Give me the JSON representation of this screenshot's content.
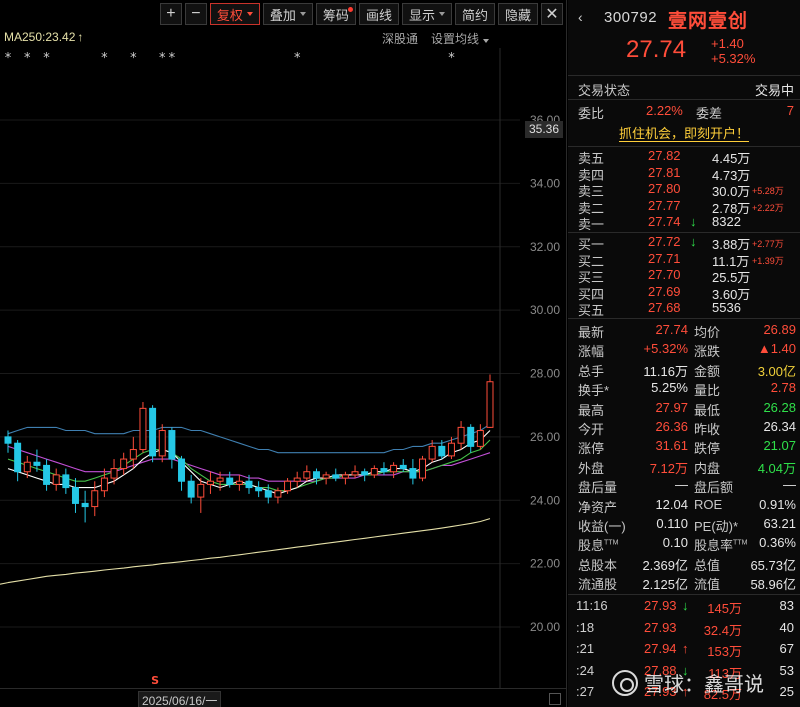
{
  "toolbar": {
    "plus": "+",
    "minus": "−",
    "fuquan": "复权",
    "diejia": "叠加",
    "chouma": "筹码",
    "huaxian": "画线",
    "xianshi": "显示",
    "jianyue": "简约",
    "yincang": "隐藏",
    "close": "✕"
  },
  "subbar": {
    "ma250": "MA250:23.42",
    "ma250_arrow": "↑",
    "shengutong": "深股通",
    "ma_setting": "设置均线"
  },
  "markers": {
    "event_mark": "*",
    "s_mark": "S"
  },
  "bottom": {
    "date": "2025/06/16/一"
  },
  "colors": {
    "up": "#ff4d3a",
    "down": "#25c8e6",
    "ma250": "#e5e0a8",
    "ma_blue": "#3f7fb0",
    "ma_purple": "#c24fd6",
    "ma_green": "#46c24a",
    "ma_white": "#ffffff"
  },
  "chart_data": {
    "type": "candlestick",
    "y_ticks": [
      "36.00",
      "34.00",
      "32.00",
      "30.00",
      "28.00",
      "26.00",
      "24.00",
      "22.00",
      "20.00"
    ],
    "ylim": [
      19.4,
      36.8
    ],
    "current_axis_label": "35.36",
    "ohlc": [
      [
        26.0,
        26.2,
        25.5,
        25.8
      ],
      [
        25.8,
        25.9,
        24.6,
        24.9
      ],
      [
        24.9,
        25.4,
        24.7,
        25.2
      ],
      [
        25.2,
        25.6,
        24.9,
        25.1
      ],
      [
        25.1,
        25.3,
        24.3,
        24.5
      ],
      [
        24.5,
        25.0,
        24.3,
        24.8
      ],
      [
        24.8,
        25.0,
        24.2,
        24.4
      ],
      [
        24.4,
        24.7,
        23.6,
        23.9
      ],
      [
        23.9,
        24.3,
        23.3,
        23.8
      ],
      [
        23.8,
        24.6,
        23.5,
        24.3
      ],
      [
        24.3,
        25.0,
        24.1,
        24.7
      ],
      [
        24.7,
        25.3,
        24.5,
        25.0
      ],
      [
        25.0,
        25.5,
        24.8,
        25.3
      ],
      [
        25.3,
        26.0,
        25.0,
        25.6
      ],
      [
        25.6,
        27.1,
        25.5,
        26.9
      ],
      [
        26.9,
        27.0,
        25.2,
        25.4
      ],
      [
        25.4,
        26.4,
        25.2,
        26.2
      ],
      [
        26.2,
        26.3,
        25.0,
        25.3
      ],
      [
        25.3,
        25.4,
        24.3,
        24.6
      ],
      [
        24.6,
        24.8,
        23.9,
        24.1
      ],
      [
        24.1,
        24.7,
        23.6,
        24.5
      ],
      [
        24.5,
        24.9,
        24.2,
        24.6
      ],
      [
        24.6,
        24.9,
        24.3,
        24.7
      ],
      [
        24.7,
        24.9,
        24.4,
        24.5
      ],
      [
        24.5,
        24.8,
        24.3,
        24.6
      ],
      [
        24.6,
        24.8,
        24.2,
        24.4
      ],
      [
        24.4,
        24.6,
        24.1,
        24.3
      ],
      [
        24.3,
        24.5,
        23.9,
        24.1
      ],
      [
        24.1,
        24.4,
        23.9,
        24.3
      ],
      [
        24.3,
        24.7,
        24.2,
        24.6
      ],
      [
        24.6,
        24.9,
        24.4,
        24.7
      ],
      [
        24.7,
        25.1,
        24.6,
        24.9
      ],
      [
        24.9,
        25.0,
        24.5,
        24.7
      ],
      [
        24.7,
        24.9,
        24.5,
        24.8
      ],
      [
        24.8,
        25.0,
        24.6,
        24.7
      ],
      [
        24.7,
        24.9,
        24.5,
        24.8
      ],
      [
        24.8,
        25.1,
        24.7,
        24.9
      ],
      [
        24.9,
        25.0,
        24.6,
        24.8
      ],
      [
        24.8,
        25.1,
        24.7,
        25.0
      ],
      [
        25.0,
        25.2,
        24.8,
        24.9
      ],
      [
        24.9,
        25.2,
        24.7,
        25.1
      ],
      [
        25.1,
        25.3,
        24.9,
        25.0
      ],
      [
        25.0,
        25.3,
        24.5,
        24.7
      ],
      [
        24.7,
        25.4,
        24.6,
        25.3
      ],
      [
        25.3,
        25.9,
        25.2,
        25.7
      ],
      [
        25.7,
        25.9,
        25.3,
        25.4
      ],
      [
        25.4,
        26.0,
        25.3,
        25.8
      ],
      [
        25.8,
        26.5,
        25.6,
        26.3
      ],
      [
        26.3,
        26.4,
        25.5,
        25.7
      ],
      [
        25.7,
        26.4,
        25.6,
        26.2
      ],
      [
        26.3,
        27.97,
        26.28,
        27.74
      ]
    ],
    "ma_lines": [
      {
        "color": "#3f7fb0",
        "values": [
          26.1,
          26.2,
          26.3,
          26.3,
          26.3,
          26.3,
          26.2,
          26.2,
          26.2,
          26.1,
          26.1,
          26.1,
          26.1,
          26.2,
          26.2,
          26.2,
          26.3,
          26.3,
          26.3,
          26.2,
          26.2,
          26.1,
          26.0,
          25.9,
          25.8,
          25.7,
          25.6,
          25.6,
          25.5,
          25.5,
          25.5,
          25.5,
          25.5,
          25.5,
          25.5,
          25.5,
          25.5,
          25.5,
          25.5,
          25.5,
          25.6,
          25.6,
          25.7,
          25.7,
          25.8,
          25.8,
          25.9,
          26.0,
          26.1,
          26.2,
          26.4
        ]
      },
      {
        "color": "#c24fd6",
        "values": [
          25.7,
          25.6,
          25.5,
          25.4,
          25.3,
          25.2,
          25.1,
          25.0,
          24.9,
          24.9,
          24.9,
          24.9,
          25.0,
          25.1,
          25.2,
          25.3,
          25.3,
          25.3,
          25.2,
          25.1,
          25.0,
          24.9,
          24.8,
          24.8,
          24.8,
          24.7,
          24.7,
          24.6,
          24.6,
          24.6,
          24.6,
          24.6,
          24.6,
          24.7,
          24.7,
          24.7,
          24.7,
          24.8,
          24.8,
          24.8,
          24.8,
          24.9,
          24.9,
          24.9,
          25.0,
          25.1,
          25.1,
          25.2,
          25.3,
          25.4,
          25.5
        ]
      },
      {
        "color": "#46c24a",
        "values": [
          25.3,
          25.2,
          25.1,
          25.0,
          24.9,
          24.8,
          24.7,
          24.6,
          24.6,
          24.7,
          24.8,
          24.9,
          25.1,
          25.3,
          25.5,
          25.6,
          25.6,
          25.5,
          25.3,
          25.0,
          24.8,
          24.6,
          24.5,
          24.5,
          24.5,
          24.5,
          24.4,
          24.4,
          24.3,
          24.3,
          24.4,
          24.5,
          24.6,
          24.7,
          24.7,
          24.8,
          24.8,
          24.8,
          24.8,
          24.9,
          24.9,
          24.9,
          24.9,
          24.9,
          25.0,
          25.1,
          25.2,
          25.3,
          25.5,
          25.6,
          25.9
        ]
      },
      {
        "color": "#ffffff",
        "values": [
          25.0,
          24.9,
          24.8,
          24.7,
          24.6,
          24.5,
          24.5,
          24.4,
          24.4,
          24.4,
          24.5,
          24.6,
          24.8,
          25.0,
          25.3,
          25.5,
          25.6,
          25.5,
          25.2,
          24.9,
          24.6,
          24.5,
          24.4,
          24.5,
          24.6,
          24.5,
          24.4,
          24.3,
          24.2,
          24.3,
          24.4,
          24.6,
          24.7,
          24.7,
          24.8,
          24.8,
          24.8,
          24.8,
          24.9,
          24.9,
          25.0,
          25.0,
          24.9,
          25.0,
          25.2,
          25.3,
          25.5,
          25.6,
          25.8,
          25.9,
          26.2
        ]
      },
      {
        "color": "#e5e0a8",
        "name": "MA250",
        "values": [
          21.4,
          21.45,
          21.5,
          21.55,
          21.6,
          21.63,
          21.66,
          21.7,
          21.73,
          21.76,
          21.8,
          21.83,
          21.86,
          21.9,
          21.93,
          21.96,
          22.0,
          22.03,
          22.06,
          22.1,
          22.13,
          22.17,
          22.2,
          22.24,
          22.28,
          22.32,
          22.36,
          22.4,
          22.44,
          22.48,
          22.52,
          22.56,
          22.6,
          22.64,
          22.68,
          22.72,
          22.76,
          22.8,
          22.84,
          22.88,
          22.92,
          22.96,
          23.0,
          23.04,
          23.08,
          23.12,
          23.17,
          23.22,
          23.27,
          23.33,
          23.42
        ]
      }
    ],
    "event_stars_at": [
      0,
      2,
      4,
      10,
      13,
      16,
      17,
      30,
      46
    ],
    "s_marker_at": 8
  },
  "quote": {
    "header": {
      "nav_left": "‹",
      "code": "300792",
      "name": "壹网壹创",
      "price": "27.74",
      "change": "+1.40",
      "change_pct": "+5.32%"
    },
    "trade_status_label": "交易状态",
    "trade_status_value": "交易中",
    "weibi_label": "委比",
    "weibi_value": "2.22%",
    "weicha_label": "委差",
    "weicha_value": "7",
    "promo": "抓住机会，即刻开户！",
    "sell": [
      {
        "label": "卖五",
        "price": "27.82",
        "vol": "4.45万",
        "ext": "",
        "arrow": ""
      },
      {
        "label": "卖四",
        "price": "27.81",
        "vol": "4.73万",
        "ext": "",
        "arrow": ""
      },
      {
        "label": "卖三",
        "price": "27.80",
        "vol": "30.0万",
        "ext": "+5.28万",
        "arrow": ""
      },
      {
        "label": "卖二",
        "price": "27.77",
        "vol": "2.78万",
        "ext": "+2.22万",
        "arrow": ""
      },
      {
        "label": "卖一",
        "price": "27.74",
        "vol": "8322",
        "ext": "",
        "arrow": "↓"
      }
    ],
    "buy": [
      {
        "label": "买一",
        "price": "27.72",
        "vol": "3.88万",
        "ext": "+2.77万",
        "arrow": "↓"
      },
      {
        "label": "买二",
        "price": "27.71",
        "vol": "11.1万",
        "ext": "+1.39万",
        "arrow": ""
      },
      {
        "label": "买三",
        "price": "27.70",
        "vol": "25.5万",
        "ext": "",
        "arrow": ""
      },
      {
        "label": "买四",
        "price": "27.69",
        "vol": "3.60万",
        "ext": "",
        "arrow": ""
      },
      {
        "label": "买五",
        "price": "27.68",
        "vol": "5536",
        "ext": "",
        "arrow": ""
      }
    ],
    "stats": [
      {
        "k1": "最新",
        "v1": "27.74",
        "c1": "red",
        "k2": "均价",
        "v2": "26.89",
        "c2": "red"
      },
      {
        "k1": "涨幅",
        "v1": "+5.32%",
        "c1": "red",
        "k2": "涨跌",
        "v2": "▲1.40",
        "c2": "red"
      },
      {
        "k1": "总手",
        "v1": "11.16万",
        "c1": "white",
        "k2": "金额",
        "v2": "3.00亿",
        "c2": "yellow"
      },
      {
        "k1": "换手*",
        "v1": "5.25%",
        "c1": "white",
        "k2": "量比",
        "v2": "2.78",
        "c2": "red"
      },
      {
        "k1": "最高",
        "v1": "27.97",
        "c1": "red",
        "k2": "最低",
        "v2": "26.28",
        "c2": "green"
      },
      {
        "k1": "今开",
        "v1": "26.36",
        "c1": "red",
        "k2": "昨收",
        "v2": "26.34",
        "c2": "white"
      },
      {
        "k1": "涨停",
        "v1": "31.61",
        "c1": "red",
        "k2": "跌停",
        "v2": "21.07",
        "c2": "green"
      },
      {
        "k1": "外盘",
        "v1": "7.12万",
        "c1": "red",
        "k2": "内盘",
        "v2": "4.04万",
        "c2": "green"
      },
      {
        "k1": "盘后量",
        "v1": "—",
        "c1": "white",
        "k2": "盘后额",
        "v2": "—",
        "c2": "white"
      },
      {
        "k1": "净资产",
        "v1": "12.04",
        "c1": "white",
        "k2": "ROE",
        "v2": "0.91%",
        "c2": "white"
      },
      {
        "k1": "收益(一)",
        "v1": "0.110",
        "c1": "white",
        "k2": "PE(动)*",
        "v2": "63.21",
        "c2": "white"
      },
      {
        "k1": "股息TTM",
        "v1": "0.10",
        "c1": "white",
        "k2": "股息率TTM",
        "v2": "0.36%",
        "c2": "white"
      },
      {
        "k1": "总股本",
        "v1": "2.369亿",
        "c1": "white",
        "k2": "总值",
        "v2": "65.73亿",
        "c2": "white"
      },
      {
        "k1": "流通股",
        "v1": "2.125亿",
        "c1": "white",
        "k2": "流值",
        "v2": "58.96亿",
        "c2": "white"
      }
    ],
    "ticks": [
      {
        "time": "11:16",
        "price": "27.93",
        "dir": "↓",
        "dc": "green",
        "vol": "145万",
        "n": "83"
      },
      {
        "time": ":18",
        "price": "27.93",
        "dir": "",
        "dc": "red",
        "vol": "32.4万",
        "n": "40"
      },
      {
        "time": ":21",
        "price": "27.94",
        "dir": "↑",
        "dc": "red",
        "vol": "153万",
        "n": "67"
      },
      {
        "time": ":24",
        "price": "27.88",
        "dir": "↓",
        "dc": "green",
        "vol": "113万",
        "n": "53"
      },
      {
        "time": ":27",
        "price": "27.93",
        "dir": "↑",
        "dc": "red",
        "vol": "82.5万",
        "n": "25"
      }
    ]
  },
  "watermark": {
    "text": "雪球：鑫哥说"
  }
}
